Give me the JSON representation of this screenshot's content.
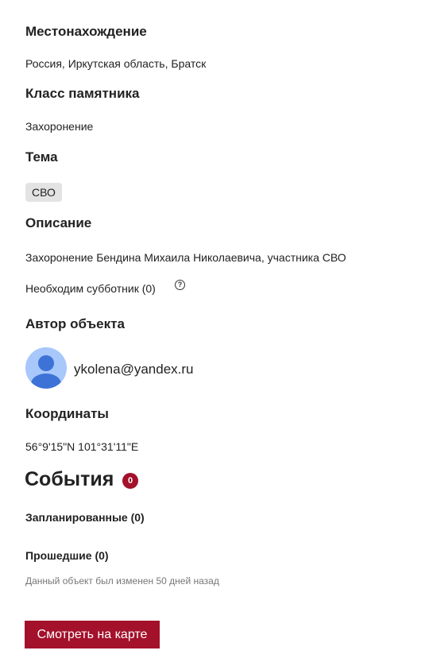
{
  "colors": {
    "accent": "#a3112b",
    "tag_bg": "#e3e3e3",
    "avatar_bg": "#a8c7fa",
    "avatar_fg": "#3d73d6",
    "muted_text": "#777777"
  },
  "location": {
    "heading": "Местонахождение",
    "value": "Россия, Иркутская область, Братск"
  },
  "monument_class": {
    "heading": "Класс памятника",
    "value": "Захоронение"
  },
  "theme": {
    "heading": "Тема",
    "tag": "СВО"
  },
  "description": {
    "heading": "Описание",
    "text": "Захоронение Бендина Михаила Николаевича, участника СВО",
    "cleanup_label": "Необходим субботник (0)",
    "help_icon": "question-circle-icon",
    "help_glyph": "?"
  },
  "author": {
    "heading": "Автор объекта",
    "avatar_icon": "user-avatar-icon",
    "email": "ykolena@yandex.ru"
  },
  "coordinates": {
    "heading": "Координаты",
    "value": "56°9'15\"N 101°31'11\"E"
  },
  "events": {
    "title": "События",
    "badge_count": "0",
    "planned_label": "Запланированные (0)",
    "past_label": "Прошедшие (0)",
    "modified_note": "Данный объект был изменен 50 дней назад"
  },
  "actions": {
    "view_on_map_label": "Смотреть на карте"
  }
}
